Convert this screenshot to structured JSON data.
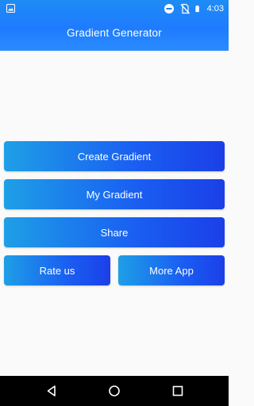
{
  "status_bar": {
    "time": "4:03",
    "icons": [
      "image-icon",
      "do-not-disturb-icon",
      "no-sim-icon",
      "battery-icon"
    ]
  },
  "app_bar": {
    "title": "Gradient Generator"
  },
  "buttons": {
    "create_gradient": "Create Gradient",
    "my_gradient": "My Gradient",
    "share": "Share",
    "rate_us": "Rate us",
    "more_app": "More App"
  },
  "colors": {
    "header_gradient": [
      "#1e8cf5",
      "#2a8bff"
    ],
    "button_gradient": [
      "#1e9fe6",
      "#1b3fe8"
    ],
    "background": "#fafafa",
    "nav_bar": "#000000"
  },
  "nav_bar": {
    "icons": [
      "back-icon",
      "home-icon",
      "recents-icon"
    ]
  }
}
